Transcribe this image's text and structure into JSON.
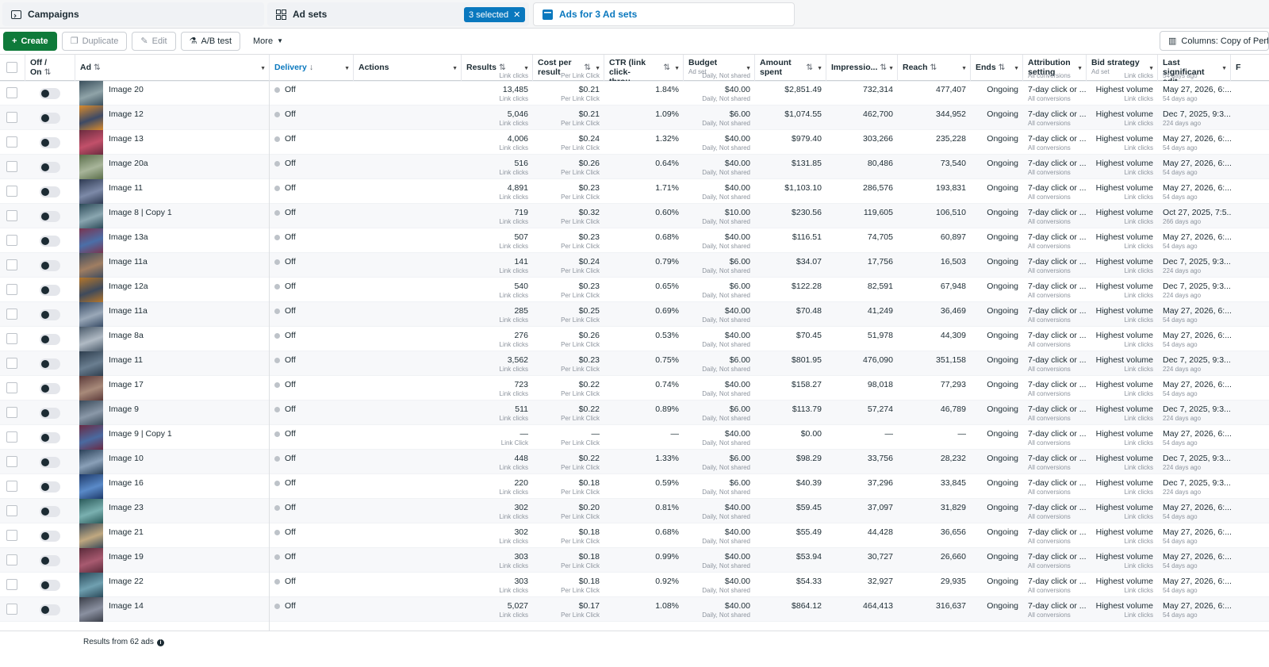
{
  "tabs": {
    "campaigns": "Campaigns",
    "adsets": "Ad sets",
    "selected": "3 selected",
    "ads": "Ads for 3 Ad sets"
  },
  "toolbar": {
    "create": "Create",
    "duplicate": "Duplicate",
    "edit": "Edit",
    "abtest": "A/B test",
    "more": "More",
    "columns": "Columns: Copy of Perform"
  },
  "headers": {
    "offon": "Off / On",
    "ad": "Ad",
    "delivery": "Delivery",
    "actions": "Actions",
    "results": "Results",
    "cpr": "Cost per result",
    "ctr": "CTR (link click-throu...",
    "budget": "Budget",
    "budget_sub": "Ad set",
    "spent": "Amount spent",
    "impressions": "Impressio...",
    "reach": "Reach",
    "ends": "Ends",
    "attribution": "Attribution setting",
    "bid": "Bid strategy",
    "bid_sub": "Ad set",
    "last_edit": "Last significant edit",
    "extra": "F"
  },
  "subs": {
    "link_clicks": "Link clicks",
    "link_click": "Link Click",
    "per_link_click": "Per Link Click",
    "daily": "Daily, Not shared",
    "all_conv": "All conversions"
  },
  "partial_row": {
    "results_sub": "Link clicks",
    "cpr_sub": "Per Link Click",
    "budget_sub": "Daily, Not shared",
    "attr_sub": "All conversions",
    "bid_sub": "Link clicks",
    "edit_sub": "54 days ago"
  },
  "rows": [
    {
      "name": "Image 20",
      "delivery": "Off",
      "results": "13,485",
      "cpr": "$0.21",
      "ctr": "1.84%",
      "budget": "$40.00",
      "spent": "$2,851.49",
      "impr": "732,314",
      "reach": "477,407",
      "ends": "Ongoing",
      "attr": "7-day click or ...",
      "bid": "Highest volume",
      "edit": "May 27, 2026, 6:...",
      "ago": "54 days ago",
      "rsub": "Link clicks"
    },
    {
      "name": "Image 12",
      "delivery": "Off",
      "results": "5,046",
      "cpr": "$0.21",
      "ctr": "1.09%",
      "budget": "$6.00",
      "spent": "$1,074.55",
      "impr": "462,700",
      "reach": "344,952",
      "ends": "Ongoing",
      "attr": "7-day click or ...",
      "bid": "Highest volume",
      "edit": "Dec 7, 2025, 9:3...",
      "ago": "224 days ago",
      "rsub": "Link clicks"
    },
    {
      "name": "Image 13",
      "delivery": "Off",
      "results": "4,006",
      "cpr": "$0.24",
      "ctr": "1.32%",
      "budget": "$40.00",
      "spent": "$979.40",
      "impr": "303,266",
      "reach": "235,228",
      "ends": "Ongoing",
      "attr": "7-day click or ...",
      "bid": "Highest volume",
      "edit": "May 27, 2026, 6:...",
      "ago": "54 days ago",
      "rsub": "Link clicks"
    },
    {
      "name": "Image 20a",
      "delivery": "Off",
      "results": "516",
      "cpr": "$0.26",
      "ctr": "0.64%",
      "budget": "$40.00",
      "spent": "$131.85",
      "impr": "80,486",
      "reach": "73,540",
      "ends": "Ongoing",
      "attr": "7-day click or ...",
      "bid": "Highest volume",
      "edit": "May 27, 2026, 6:...",
      "ago": "54 days ago",
      "rsub": "Link clicks"
    },
    {
      "name": "Image 11",
      "delivery": "Off",
      "results": "4,891",
      "cpr": "$0.23",
      "ctr": "1.71%",
      "budget": "$40.00",
      "spent": "$1,103.10",
      "impr": "286,576",
      "reach": "193,831",
      "ends": "Ongoing",
      "attr": "7-day click or ...",
      "bid": "Highest volume",
      "edit": "May 27, 2026, 6:...",
      "ago": "54 days ago",
      "rsub": "Link clicks"
    },
    {
      "name": "Image 8 | Copy 1",
      "delivery": "Off",
      "results": "719",
      "cpr": "$0.32",
      "ctr": "0.60%",
      "budget": "$10.00",
      "spent": "$230.56",
      "impr": "119,605",
      "reach": "106,510",
      "ends": "Ongoing",
      "attr": "7-day click or ...",
      "bid": "Highest volume",
      "edit": "Oct 27, 2025, 7:5...",
      "ago": "266 days ago",
      "rsub": "Link clicks"
    },
    {
      "name": "Image 13a",
      "delivery": "Off",
      "results": "507",
      "cpr": "$0.23",
      "ctr": "0.68%",
      "budget": "$40.00",
      "spent": "$116.51",
      "impr": "74,705",
      "reach": "60,897",
      "ends": "Ongoing",
      "attr": "7-day click or ...",
      "bid": "Highest volume",
      "edit": "May 27, 2026, 6:...",
      "ago": "54 days ago",
      "rsub": "Link clicks"
    },
    {
      "name": "Image 11a",
      "delivery": "Off",
      "results": "141",
      "cpr": "$0.24",
      "ctr": "0.79%",
      "budget": "$6.00",
      "spent": "$34.07",
      "impr": "17,756",
      "reach": "16,503",
      "ends": "Ongoing",
      "attr": "7-day click or ...",
      "bid": "Highest volume",
      "edit": "Dec 7, 2025, 9:3...",
      "ago": "224 days ago",
      "rsub": "Link clicks"
    },
    {
      "name": "Image 12a",
      "delivery": "Off",
      "results": "540",
      "cpr": "$0.23",
      "ctr": "0.65%",
      "budget": "$6.00",
      "spent": "$122.28",
      "impr": "82,591",
      "reach": "67,948",
      "ends": "Ongoing",
      "attr": "7-day click or ...",
      "bid": "Highest volume",
      "edit": "Dec 7, 2025, 9:3...",
      "ago": "224 days ago",
      "rsub": "Link clicks"
    },
    {
      "name": "Image 11a",
      "delivery": "Off",
      "results": "285",
      "cpr": "$0.25",
      "ctr": "0.69%",
      "budget": "$40.00",
      "spent": "$70.48",
      "impr": "41,249",
      "reach": "36,469",
      "ends": "Ongoing",
      "attr": "7-day click or ...",
      "bid": "Highest volume",
      "edit": "May 27, 2026, 6:...",
      "ago": "54 days ago",
      "rsub": "Link clicks"
    },
    {
      "name": "Image 8a",
      "delivery": "Off",
      "results": "276",
      "cpr": "$0.26",
      "ctr": "0.53%",
      "budget": "$40.00",
      "spent": "$70.45",
      "impr": "51,978",
      "reach": "44,309",
      "ends": "Ongoing",
      "attr": "7-day click or ...",
      "bid": "Highest volume",
      "edit": "May 27, 2026, 6:...",
      "ago": "54 days ago",
      "rsub": "Link clicks"
    },
    {
      "name": "Image 11",
      "delivery": "Off",
      "results": "3,562",
      "cpr": "$0.23",
      "ctr": "0.75%",
      "budget": "$6.00",
      "spent": "$801.95",
      "impr": "476,090",
      "reach": "351,158",
      "ends": "Ongoing",
      "attr": "7-day click or ...",
      "bid": "Highest volume",
      "edit": "Dec 7, 2025, 9:3...",
      "ago": "224 days ago",
      "rsub": "Link clicks"
    },
    {
      "name": "Image 17",
      "delivery": "Off",
      "results": "723",
      "cpr": "$0.22",
      "ctr": "0.74%",
      "budget": "$40.00",
      "spent": "$158.27",
      "impr": "98,018",
      "reach": "77,293",
      "ends": "Ongoing",
      "attr": "7-day click or ...",
      "bid": "Highest volume",
      "edit": "May 27, 2026, 6:...",
      "ago": "54 days ago",
      "rsub": "Link clicks"
    },
    {
      "name": "Image 9",
      "delivery": "Off",
      "results": "511",
      "cpr": "$0.22",
      "ctr": "0.89%",
      "budget": "$6.00",
      "spent": "$113.79",
      "impr": "57,274",
      "reach": "46,789",
      "ends": "Ongoing",
      "attr": "7-day click or ...",
      "bid": "Highest volume",
      "edit": "Dec 7, 2025, 9:3...",
      "ago": "224 days ago",
      "rsub": "Link clicks"
    },
    {
      "name": "Image 9 | Copy 1",
      "delivery": "Off",
      "results": "—",
      "cpr": "—",
      "ctr": "—",
      "budget": "$40.00",
      "spent": "$0.00",
      "impr": "—",
      "reach": "—",
      "ends": "Ongoing",
      "attr": "7-day click or ...",
      "bid": "Highest volume",
      "edit": "May 27, 2026, 6:...",
      "ago": "54 days ago",
      "rsub": "Link Click"
    },
    {
      "name": "Image 10",
      "delivery": "Off",
      "results": "448",
      "cpr": "$0.22",
      "ctr": "1.33%",
      "budget": "$6.00",
      "spent": "$98.29",
      "impr": "33,756",
      "reach": "28,232",
      "ends": "Ongoing",
      "attr": "7-day click or ...",
      "bid": "Highest volume",
      "edit": "Dec 7, 2025, 9:3...",
      "ago": "224 days ago",
      "rsub": "Link clicks"
    },
    {
      "name": "Image 16",
      "delivery": "Off",
      "results": "220",
      "cpr": "$0.18",
      "ctr": "0.59%",
      "budget": "$6.00",
      "spent": "$40.39",
      "impr": "37,296",
      "reach": "33,845",
      "ends": "Ongoing",
      "attr": "7-day click or ...",
      "bid": "Highest volume",
      "edit": "Dec 7, 2025, 9:3...",
      "ago": "224 days ago",
      "rsub": "Link clicks"
    },
    {
      "name": "Image 23",
      "delivery": "Off",
      "results": "302",
      "cpr": "$0.20",
      "ctr": "0.81%",
      "budget": "$40.00",
      "spent": "$59.45",
      "impr": "37,097",
      "reach": "31,829",
      "ends": "Ongoing",
      "attr": "7-day click or ...",
      "bid": "Highest volume",
      "edit": "May 27, 2026, 6:...",
      "ago": "54 days ago",
      "rsub": "Link clicks"
    },
    {
      "name": "Image 21",
      "delivery": "Off",
      "results": "302",
      "cpr": "$0.18",
      "ctr": "0.68%",
      "budget": "$40.00",
      "spent": "$55.49",
      "impr": "44,428",
      "reach": "36,656",
      "ends": "Ongoing",
      "attr": "7-day click or ...",
      "bid": "Highest volume",
      "edit": "May 27, 2026, 6:...",
      "ago": "54 days ago",
      "rsub": "Link clicks"
    },
    {
      "name": "Image 19",
      "delivery": "Off",
      "results": "303",
      "cpr": "$0.18",
      "ctr": "0.99%",
      "budget": "$40.00",
      "spent": "$53.94",
      "impr": "30,727",
      "reach": "26,660",
      "ends": "Ongoing",
      "attr": "7-day click or ...",
      "bid": "Highest volume",
      "edit": "May 27, 2026, 6:...",
      "ago": "54 days ago",
      "rsub": "Link clicks"
    },
    {
      "name": "Image 22",
      "delivery": "Off",
      "results": "303",
      "cpr": "$0.18",
      "ctr": "0.92%",
      "budget": "$40.00",
      "spent": "$54.33",
      "impr": "32,927",
      "reach": "29,935",
      "ends": "Ongoing",
      "attr": "7-day click or ...",
      "bid": "Highest volume",
      "edit": "May 27, 2026, 6:...",
      "ago": "54 days ago",
      "rsub": "Link clicks"
    },
    {
      "name": "Image 14",
      "delivery": "Off",
      "results": "5,027",
      "cpr": "$0.17",
      "ctr": "1.08%",
      "budget": "$40.00",
      "spent": "$864.12",
      "impr": "464,413",
      "reach": "316,637",
      "ends": "Ongoing",
      "attr": "7-day click or ...",
      "bid": "Highest volume",
      "edit": "May 27, 2026, 6:...",
      "ago": "54 days ago",
      "rsub": "Link clicks"
    }
  ],
  "footer": {
    "text": "Results from 62 ads"
  },
  "colors": {
    "accent": "#0a78be",
    "create": "#0f7a3a"
  },
  "thumb_palettes": [
    [
      "#3a4f5c",
      "#8fa3a8"
    ],
    [
      "#d98a2b",
      "#3d4a66"
    ],
    [
      "#6b2b3f",
      "#c2506a"
    ],
    [
      "#5a6e4a",
      "#a8b59a"
    ],
    [
      "#2e3a52",
      "#7d8aa8"
    ],
    [
      "#2c4a58",
      "#8aa6b0"
    ],
    [
      "#7a3550",
      "#4b6fa8"
    ],
    [
      "#3f4c5e",
      "#a07e62"
    ],
    [
      "#b5762a",
      "#3e4a5c"
    ],
    [
      "#384c66",
      "#9aa8b8"
    ],
    [
      "#4a5a6a",
      "#b0bac4"
    ],
    [
      "#2e3e4e",
      "#6a7e90"
    ],
    [
      "#5c3a3a",
      "#a88a7a"
    ],
    [
      "#3a4a5a",
      "#8a98a8"
    ],
    [
      "#6a2a44",
      "#4a6aa0"
    ],
    [
      "#2a4058",
      "#8aa0b8"
    ],
    [
      "#1e3a6a",
      "#5a8ac8"
    ],
    [
      "#2a5a5a",
      "#7ab0b0"
    ],
    [
      "#3a4a58",
      "#c0a880"
    ],
    [
      "#5a2a3a",
      "#a85a70"
    ],
    [
      "#2a4a5a",
      "#70a0b0"
    ],
    [
      "#3a3e48",
      "#8a90a0"
    ]
  ]
}
